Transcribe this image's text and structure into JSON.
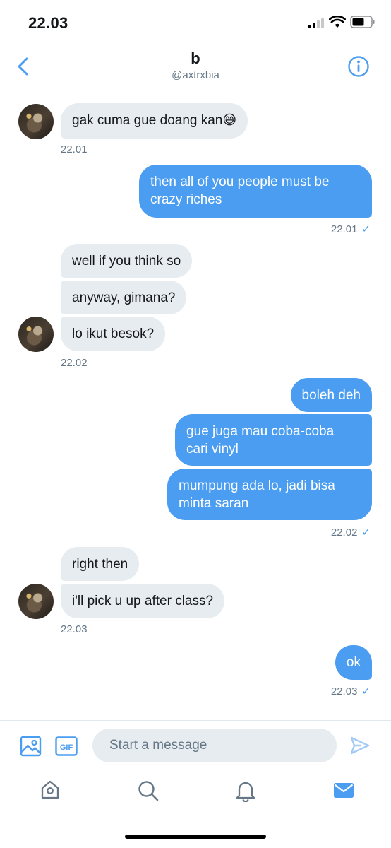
{
  "status_bar": {
    "time": "22.03"
  },
  "header": {
    "title": "b",
    "handle": "@axtrxbia"
  },
  "messages": [
    {
      "text": "gak cuma gue doang kan😅"
    },
    {
      "text": "then all of you people must be",
      "text2": "crazy riches"
    },
    {
      "text": "well if you think so"
    },
    {
      "text": "anyway, gimana?"
    },
    {
      "text": "lo ikut besok?"
    },
    {
      "text": "boleh deh"
    },
    {
      "text": "gue juga mau coba-coba",
      "text2": "cari vinyl"
    },
    {
      "text": "mumpung ada lo, jadi bisa",
      "text2": "minta saran"
    },
    {
      "text": "right then"
    },
    {
      "text": "i'll pick u up after class?"
    },
    {
      "text": "ok"
    }
  ],
  "timestamps": [
    "22.01",
    "22.01",
    "22.02",
    "22.02",
    "22.03",
    "22.03"
  ],
  "read_mark": "✓",
  "composer": {
    "placeholder": "Start a message",
    "gif_label": "GIF"
  },
  "colors": {
    "accent": "#4a9df0",
    "incoming_bubble": "#e6ecf0",
    "secondary_text": "#657786"
  },
  "icons": {
    "back": "chevron-left-icon",
    "info": "info-icon",
    "media": "image-icon",
    "gif": "gif-icon",
    "send": "send-icon",
    "home": "home-icon",
    "search": "search-icon",
    "notifications": "bell-icon",
    "messages": "mail-icon"
  }
}
